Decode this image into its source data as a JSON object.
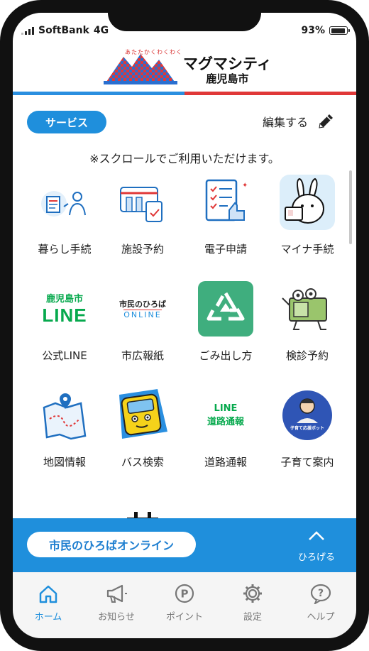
{
  "status_bar": {
    "carrier": "SoftBank",
    "network": "4G",
    "battery": "93%"
  },
  "header": {
    "tagline": "あたたかくわくわく",
    "title": "マグマシティ",
    "subtitle": "鹿児島市"
  },
  "service": {
    "label": "サービス",
    "edit_label": "編集する"
  },
  "scroll_note": "※スクロールでご利用いただけます。",
  "tiles": [
    {
      "label": "暮らし手続",
      "icon": "procedures-icon"
    },
    {
      "label": "施設予約",
      "icon": "facility-reservation-icon"
    },
    {
      "label": "電子申請",
      "icon": "e-application-icon"
    },
    {
      "label": "マイナ手続",
      "icon": "mynumber-rabbit-icon"
    },
    {
      "label": "公式LINE",
      "icon": "line-logo",
      "line_city": "鹿児島市",
      "line_text": "LINE"
    },
    {
      "label": "市広報紙",
      "icon": "city-newsletter-logo",
      "logo_top": "市民のひろば",
      "logo_bottom": "ONLINE"
    },
    {
      "label": "ごみ出し方",
      "icon": "recycle-icon"
    },
    {
      "label": "検診予約",
      "icon": "checkup-character-icon"
    },
    {
      "label": "地図情報",
      "icon": "map-icon"
    },
    {
      "label": "バス検索",
      "icon": "bus-character-icon"
    },
    {
      "label": "道路通報",
      "icon": "road-report-logo",
      "line_text": "LINE",
      "road_text": "道路通報"
    },
    {
      "label": "子育て案内",
      "icon": "childcare-bot-icon",
      "bot_text": "子育て応援ボット"
    }
  ],
  "banner": {
    "label": "市民のひろばオンライン",
    "expand_label": "ひろげる"
  },
  "tabbar": [
    {
      "label": "ホーム",
      "icon": "home-icon",
      "active": true
    },
    {
      "label": "お知らせ",
      "icon": "megaphone-icon",
      "active": false
    },
    {
      "label": "ポイント",
      "icon": "point-icon",
      "active": false
    },
    {
      "label": "設定",
      "icon": "gear-icon",
      "active": false
    },
    {
      "label": "ヘルプ",
      "icon": "help-icon",
      "active": false
    }
  ],
  "colors": {
    "primary": "#1f8fdc",
    "accent_red": "#e03838",
    "line_green": "#06a94d"
  }
}
